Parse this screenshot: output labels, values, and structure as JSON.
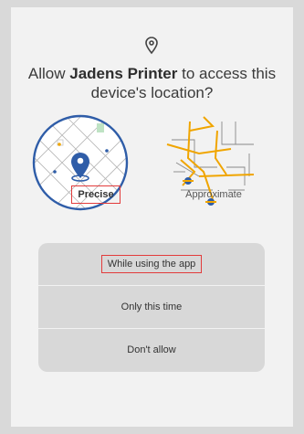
{
  "dialog": {
    "title_prefix": "Allow ",
    "app_name": "Jadens Printer",
    "title_suffix": " to access this device's location?",
    "options": {
      "precise_label": "Precise",
      "approximate_label": "Approximate"
    },
    "choices": [
      {
        "label": "While using the app"
      },
      {
        "label": "Only this time"
      },
      {
        "label": "Don't allow"
      }
    ],
    "colors": {
      "accent_blue": "#2f5da8",
      "map_orange": "#f0a500",
      "highlight_red": "#e23b3b"
    }
  }
}
